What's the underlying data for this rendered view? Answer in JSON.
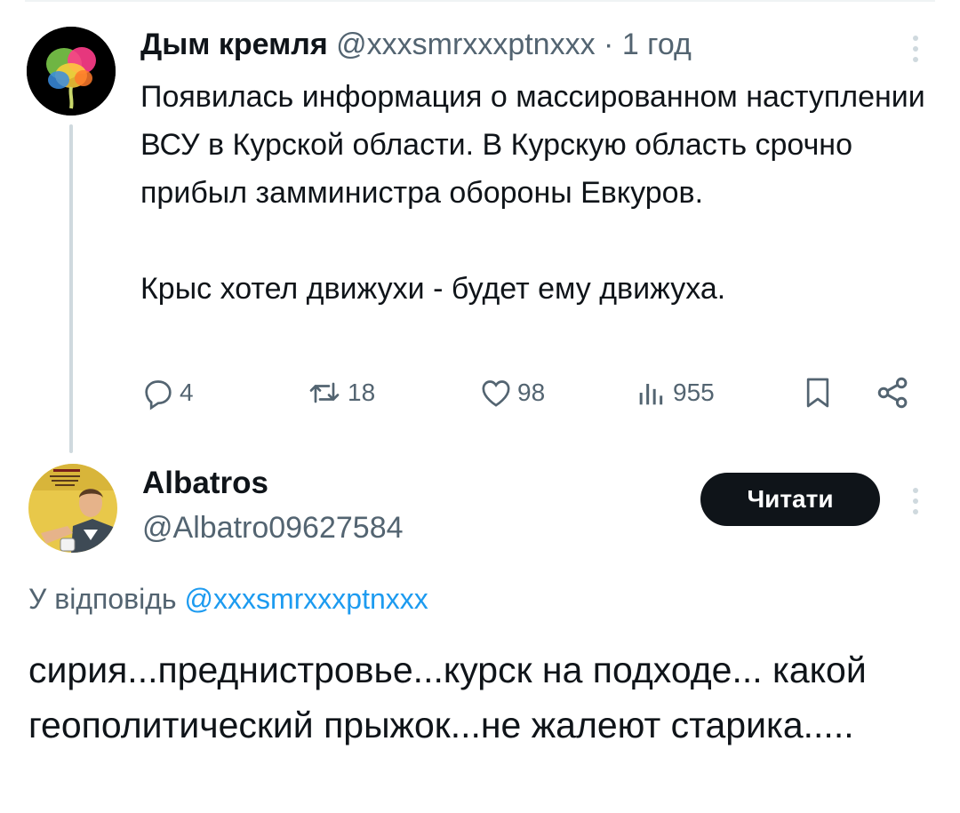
{
  "parent_tweet": {
    "author_name": "Дым кремля",
    "handle": "@xxxsmrxxxptnxxx",
    "separator": "·",
    "time": "1 год",
    "text_paragraph_1": "Появилась информация о массированном наступлении ВСУ в Курской области. В Курскую область срочно прибыл замминистра обороны Евкуров.",
    "text_paragraph_2": "Крыс хотел движухи - будет ему движуха.",
    "metrics": {
      "replies": "4",
      "retweets": "18",
      "likes": "98",
      "views": "955"
    },
    "icons": [
      "reply-icon",
      "retweet-icon",
      "like-icon",
      "views-icon",
      "bookmark-icon",
      "share-icon",
      "more-icon"
    ]
  },
  "reply_tweet": {
    "author_name": "Albatros",
    "handle": "@Albatro09627584",
    "follow_label": "Читати",
    "replying_to_prefix": "У відповідь",
    "replying_to_handle": "@xxxsmrxxxptnxxx",
    "text": "сирия...преднистровье...курск на подходе... какой геополитический прыжок...не жалеют старика....."
  },
  "colors": {
    "text": "#0f1419",
    "secondary": "#536471",
    "link": "#1d9bf0",
    "button_bg": "#0f1419",
    "thread_line": "#cfd9de"
  }
}
